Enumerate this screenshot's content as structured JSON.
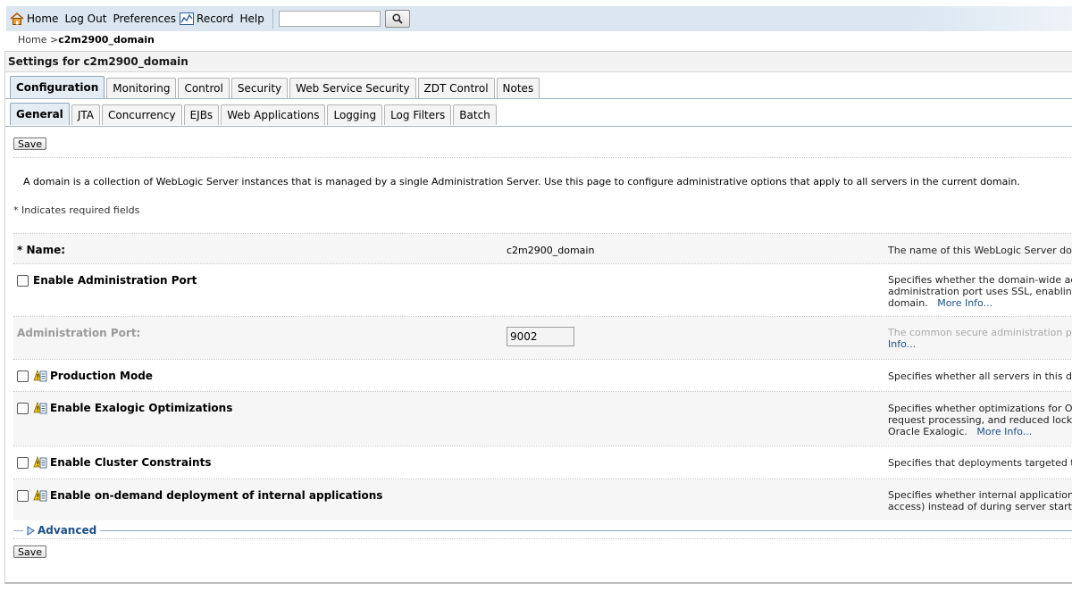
{
  "toolbar": {
    "home": "Home",
    "logout": "Log Out",
    "preferences": "Preferences",
    "record": "Record",
    "help": "Help",
    "search_value": ""
  },
  "breadcrumb": {
    "home": "Home >",
    "current": "c2m2900_domain"
  },
  "panel_title": "Settings for c2m2900_domain",
  "main_tabs": [
    "Configuration",
    "Monitoring",
    "Control",
    "Security",
    "Web Service Security",
    "ZDT Control",
    "Notes"
  ],
  "sub_tabs": [
    "General",
    "JTA",
    "Concurrency",
    "EJBs",
    "Web Applications",
    "Logging",
    "Log Filters",
    "Batch"
  ],
  "save_label": "Save",
  "description": "A domain is a collection of WebLogic Server instances that is managed by a single Administration Server. Use this page to configure administrative options that apply to all servers in the current domain.",
  "required_note": "* Indicates required fields",
  "fields": {
    "name": {
      "label": "* Name:",
      "value": "c2m2900_domain",
      "help": "The name of this WebLogic Server domain."
    },
    "admin_port_enable": {
      "label": "Enable Administration Port",
      "help1": "Specifies whether the domain-wide adminis",
      "help2": "administration port uses SSL, enabling the",
      "help3": "domain.",
      "more": "More Info..."
    },
    "admin_port": {
      "label": "Administration Port:",
      "value": "9002",
      "help1": "The common secure administration port fo",
      "help2": "Info..."
    },
    "production_mode": {
      "label": "Production Mode",
      "help": "Specifies whether all servers in this domair"
    },
    "exalogic": {
      "label": "Enable Exalogic Optimizations",
      "help1": "Specifies whether optimizations for Oracle",
      "help2": "request processing, and reduced lock conte",
      "help3": "Oracle Exalogic.",
      "more": "More Info..."
    },
    "cluster": {
      "label": "Enable Cluster Constraints",
      "help": "Specifies that deployments targeted to a cl"
    },
    "ondemand": {
      "label": "Enable on-demand deployment of internal applications",
      "help1": "Specifies whether internal applications such",
      "help2": "access) instead of during server startup."
    }
  },
  "advanced_label": "Advanced"
}
